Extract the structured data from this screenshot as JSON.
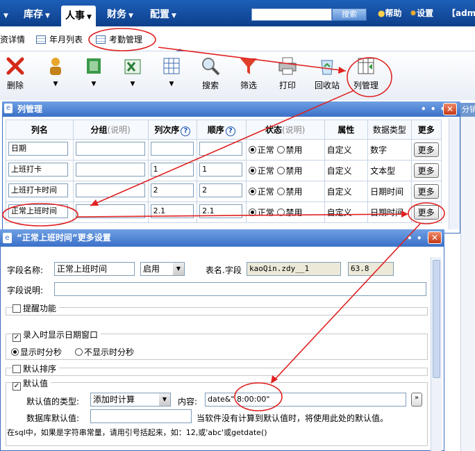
{
  "nav": {
    "items": [
      {
        "label": "库存"
      },
      {
        "label": "人事"
      },
      {
        "label": "财务"
      },
      {
        "label": "配置"
      }
    ],
    "search_button": "搜索",
    "help": "帮助",
    "settings": "设置",
    "user": "【admi"
  },
  "tabs": [
    {
      "label": "资详情"
    },
    {
      "label": "年月列表"
    },
    {
      "label": "考勤管理"
    }
  ],
  "toolbar": {
    "delete": "删除",
    "search": "搜索",
    "filter": "筛选",
    "print": "打印",
    "recycle": "回收站",
    "columns": "列管理"
  },
  "side_text": "分销",
  "column_dialog": {
    "title": "列管理",
    "headers": {
      "name": "列名",
      "group": "分组",
      "group_hint": "(说明)",
      "col_order": "列次序",
      "order": "顺序",
      "status": "状态",
      "status_hint": "(说明)",
      "attribute": "属性",
      "data_type": "数据类型",
      "more": "更多"
    },
    "normal": "正常",
    "disabled": "禁用",
    "more_button": "更多",
    "rows": [
      {
        "name": "日期",
        "group": "",
        "col_order": "",
        "order": "",
        "attribute": "自定义",
        "data_type": "数字"
      },
      {
        "name": "上班打卡",
        "group": "",
        "col_order": "1",
        "order": "1",
        "attribute": "自定义",
        "data_type": "文本型"
      },
      {
        "name": "上班打卡时间",
        "group": "",
        "col_order": "2",
        "order": "2",
        "attribute": "自定义",
        "data_type": "日期时间"
      },
      {
        "name": "正常上班时间",
        "group": "",
        "col_order": "2.1",
        "order": "2.1",
        "attribute": "自定义",
        "data_type": "日期时间"
      }
    ]
  },
  "more_dialog": {
    "title": "“正常上班时间”更多设置",
    "field_name_label": "字段名称:",
    "field_name_value": "正常上班时间",
    "enable_value": "启用",
    "table_field_label": "表名.字段",
    "table_field_value": "kaoQin.zdy__1",
    "width_value": "63.8",
    "desc_label": "字段说明:",
    "desc_value": "",
    "reminder_label": "提醒功能",
    "show_date_label": "录入时显示日期窗口",
    "show_hms": "显示时分秒",
    "hide_hms": "不显示时分秒",
    "default_sort_label": "默认排序",
    "default_value_label": "默认值",
    "default_type_label": "默认值的类型:",
    "default_type_value": "添加时计算",
    "content_label": "内容:",
    "content_value": "date&\" 8:00:00\"",
    "content_button": "»",
    "db_default_label": "数据库默认值:",
    "db_default_value": "",
    "db_default_hint": "当软件没有计算到默认值时，将使用此处的默认值。",
    "sql_hint": "在sql中，如果是字符串常量，请用引号括起来，如：12,或'abc'或getdate()"
  },
  "colors": {
    "nav_blue": "#1d5fb8",
    "title_blue": "#3a70c8",
    "annotation_red": "#e02020"
  }
}
